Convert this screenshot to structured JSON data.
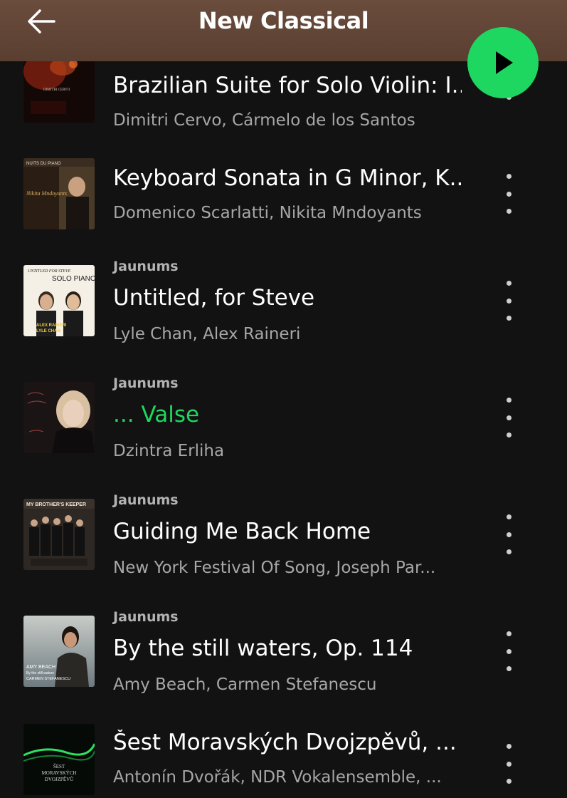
{
  "header": {
    "title": "New Classical",
    "back_icon": "arrow-left-icon",
    "play_icon": "play-icon",
    "accent_color": "#1ed760",
    "header_color": "#6a4c3c"
  },
  "tracks": [
    {
      "badge": "",
      "title": "Brazilian Suite for Solo Violin: I...",
      "artists": "Dimitri Cervo, Cármelo de los Santos",
      "cover_text": "DIMITRI CERVO",
      "playing": false
    },
    {
      "badge": "",
      "title": "Keyboard Sonata in G Minor, K...",
      "artists": "Domenico Scarlatti, Nikita Mndoyants",
      "cover_text": "NUITS DU PIANO",
      "cover_text_2": "Nikita Mndoyants",
      "playing": false
    },
    {
      "badge": "Jaunums",
      "title": "Untitled, for Steve",
      "artists": "Lyle Chan, Alex Raineri",
      "cover_text": "UNTITLED FOR STEVE",
      "cover_text_2": "SOLO PIANO",
      "cover_text_3": "ALEX RAINERI",
      "cover_text_4": "LYLE CHAN",
      "playing": false
    },
    {
      "badge": "Jaunums",
      "title": "... Valse",
      "artists": "Dzintra Erliha",
      "cover_text": "",
      "playing": true
    },
    {
      "badge": "Jaunums",
      "title": "Guiding Me Back Home",
      "artists": "New York Festival Of Song, Joseph Par...",
      "cover_text": "MY BROTHER'S KEEPER",
      "playing": false
    },
    {
      "badge": "Jaunums",
      "title": "By the still waters, Op. 114",
      "artists": "Amy Beach, Carmen Stefanescu",
      "cover_text": "AMY BEACH",
      "cover_text_2": "By the still waters",
      "cover_text_3": "CARMEN STEFANESCU",
      "playing": false
    },
    {
      "badge": "",
      "title": "Šest Moravských Dvojzpěvů, ...",
      "artists": "Antonín Dvořák, NDR Vokalensemble, ...",
      "cover_text": "ŠEST",
      "cover_text_2": "MORAVSKÝCH",
      "cover_text_3": "DVOJZPĚVŮ",
      "playing": false
    }
  ],
  "more_icon": "more-vertical-icon"
}
